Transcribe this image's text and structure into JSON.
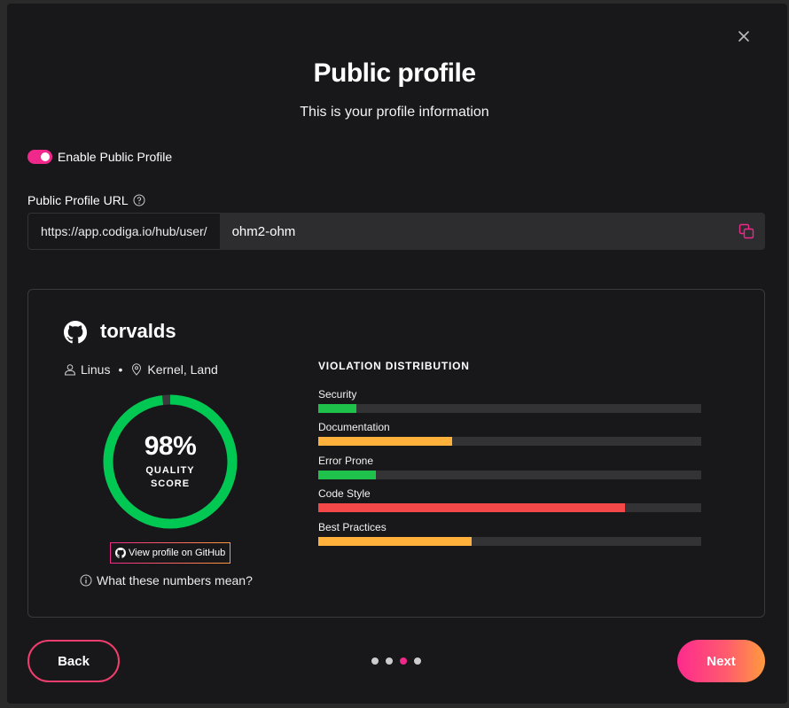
{
  "modal": {
    "title": "Public profile",
    "subtitle": "This is your profile information",
    "close_icon": "close-icon"
  },
  "toggle": {
    "label": "Enable Public Profile",
    "enabled": true,
    "color": "#f0288c"
  },
  "url": {
    "label": "Public Profile URL",
    "help_icon": "question-circle-icon",
    "prefix": "https://app.codiga.io/hub/user/",
    "value": "ohm2-ohm",
    "copy_icon": "copy-icon"
  },
  "profile": {
    "github_icon": "github-icon",
    "username": "torvalds",
    "name": "Linus",
    "separator": "•",
    "location": "Kernel, Land",
    "score": {
      "value": "98%",
      "percent": 98,
      "label": "QUALITY SCORE",
      "color": "#00c853"
    },
    "github_button": "View profile on GitHub",
    "help_link": "What these numbers mean?"
  },
  "violation_distribution": {
    "title": "VIOLATION DISTRIBUTION",
    "items": [
      {
        "label": "Security",
        "fraction": 0.1,
        "color": "#1ec24a"
      },
      {
        "label": "Documentation",
        "fraction": 0.35,
        "color": "#ffb13b"
      },
      {
        "label": "Error Prone",
        "fraction": 0.15,
        "color": "#1ec24a"
      },
      {
        "label": "Code Style",
        "fraction": 0.8,
        "color": "#f44848"
      },
      {
        "label": "Best Practices",
        "fraction": 0.4,
        "color": "#ffb13b"
      }
    ]
  },
  "footer": {
    "back_label": "Back",
    "next_label": "Next",
    "pages_total": 4,
    "current_page": 3
  }
}
